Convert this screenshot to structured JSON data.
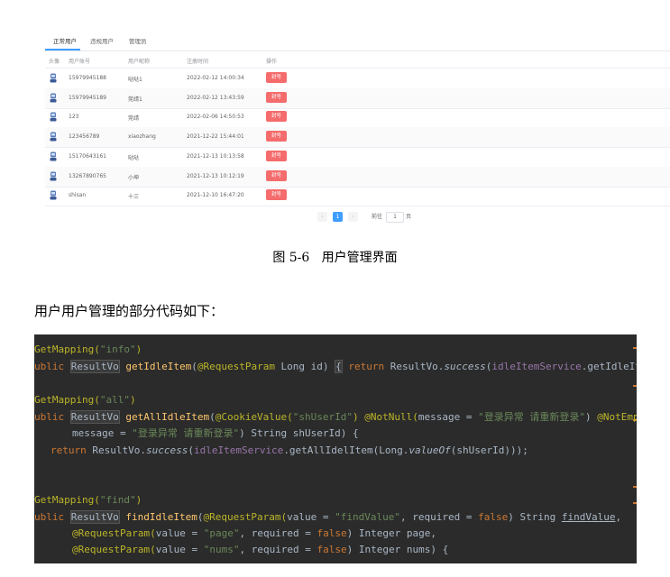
{
  "tabs": [
    {
      "label": "正常用户",
      "active": true
    },
    {
      "label": "违规用户",
      "active": false
    },
    {
      "label": "管理员",
      "active": false
    }
  ],
  "table": {
    "headers": [
      "头像",
      "用户账号",
      "用户昵称",
      "注册时间",
      "操作"
    ],
    "action_label": "封号",
    "rows": [
      {
        "account": "15979945188",
        "nickname": "哒哒1",
        "time": "2022-02-12 14:00:34"
      },
      {
        "account": "15979945189",
        "nickname": "莞靖1",
        "time": "2022-02-12 13:43:59"
      },
      {
        "account": "123",
        "nickname": "莞靖",
        "time": "2022-02-06 14:50:53"
      },
      {
        "account": "123456789",
        "nickname": "xiaozhang",
        "time": "2021-12-22 15:44:01"
      },
      {
        "account": "15170643161",
        "nickname": "哒哒",
        "time": "2021-12-13 10:13:58"
      },
      {
        "account": "13267890765",
        "nickname": "小坤",
        "time": "2021-12-13 10:12:19"
      },
      {
        "account": "shisan",
        "nickname": "十三",
        "time": "2021-12-10 16:47:20"
      }
    ]
  },
  "pagination": {
    "prev": "‹",
    "current": "1",
    "next": "›",
    "goto_label": "前往",
    "goto_value": "1",
    "page_suffix": "页"
  },
  "caption": "图 5-6   用户管理界面",
  "intro": "用户用户管理的部分代码如下：",
  "code": {
    "l1_ann": "GetMapping(",
    "l1_str": "\"info\"",
    "l1_end": ")",
    "l2_kw": "ublic ",
    "l2_type": "ResultVo",
    "l2_fn": " getIdleItem",
    "l2_a": "(",
    "l2_ann": "@RequestParam",
    "l2_b": " Long id) ",
    "l2_brace": "{",
    "l2_ret": " return",
    "l2_c": " ResultVo.",
    "l2_it": "success",
    "l2_d": "(",
    "l2_purp": "idleItemService",
    "l2_e": ".getIdleItem(",
    "l3_ann": "GetMapping(",
    "l3_str": "\"all\"",
    "l3_end": ")",
    "l4_kw": "ublic ",
    "l4_type": "ResultVo",
    "l4_fn": " getAllIdleItem",
    "l4_a": "(",
    "l4_ann": "@CookieValue(",
    "l4_str": "\"shUserId\"",
    "l4_b": ") ",
    "l4_ann2": "@NotNull(",
    "l4_c": "message = ",
    "l4_str2": "\"登录异常 请重新登录\"",
    "l4_d": ") ",
    "l4_ann3": "@NotEmpt",
    "l5_a": "message = ",
    "l5_str": "\"登录异常 请重新登录\"",
    "l5_b": ") String shUserId) {",
    "l6_kw": "return",
    "l6_a": " ResultVo.",
    "l6_it": "success",
    "l6_b": "(",
    "l6_purp": "idleItemService",
    "l6_c": ".getAllIdelItem(Long.",
    "l6_it2": "valueOf",
    "l6_d": "(shUserId)));",
    "l7_ann": "GetMapping(",
    "l7_str": "\"find\"",
    "l7_end": ")",
    "l8_kw": "ublic ",
    "l8_type": "ResultVo",
    "l8_fn": " findIdleItem",
    "l8_a": "(",
    "l8_ann": "@RequestParam(",
    "l8_b": "value = ",
    "l8_str": "\"findValue\"",
    "l8_c": ", required = ",
    "l8_kw2": "false",
    "l8_d": ") String ",
    "l8_ul": "findValue",
    "l8_e": ",",
    "l9_ann": "@RequestParam(",
    "l9_a": "value = ",
    "l9_str": "\"page\"",
    "l9_b": ", required = ",
    "l9_kw": "false",
    "l9_c": ") Integer page,",
    "l10_ann": "@RequestParam(",
    "l10_a": "value = ",
    "l10_str": "\"nums\"",
    "l10_b": ", required = ",
    "l10_kw": "false",
    "l10_c": ") Integer nums) {"
  },
  "colors": {
    "accent": "#409eff",
    "danger": "#f56c6c",
    "code_bg": "#2b2b2b"
  }
}
